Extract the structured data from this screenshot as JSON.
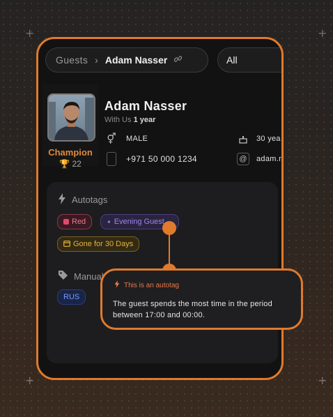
{
  "breadcrumb": {
    "root": "Guests",
    "current": "Adam Nasser"
  },
  "filter": {
    "value": "All"
  },
  "profile": {
    "name": "Adam Nasser",
    "with_us_label": "With Us",
    "with_us_value": "1 year",
    "badge": "Champion",
    "trophies": "22",
    "gender": "MALE",
    "age": "30 yea",
    "phone": "+971 50 000 1234",
    "email": "adam.n"
  },
  "autotags": {
    "title": "Autotags",
    "tags": [
      "Red",
      "Evening Guest",
      "Gone for 30 Days"
    ]
  },
  "manual_tags": {
    "title": "Manual T",
    "tags": [
      "RUS"
    ]
  },
  "tooltip": {
    "heading": "This is an autotag",
    "body": "The guest spends the most time in the period between 17:00 and 00:00."
  },
  "colors": {
    "accent": "#e07a2c",
    "champion": "#e08a3c"
  }
}
